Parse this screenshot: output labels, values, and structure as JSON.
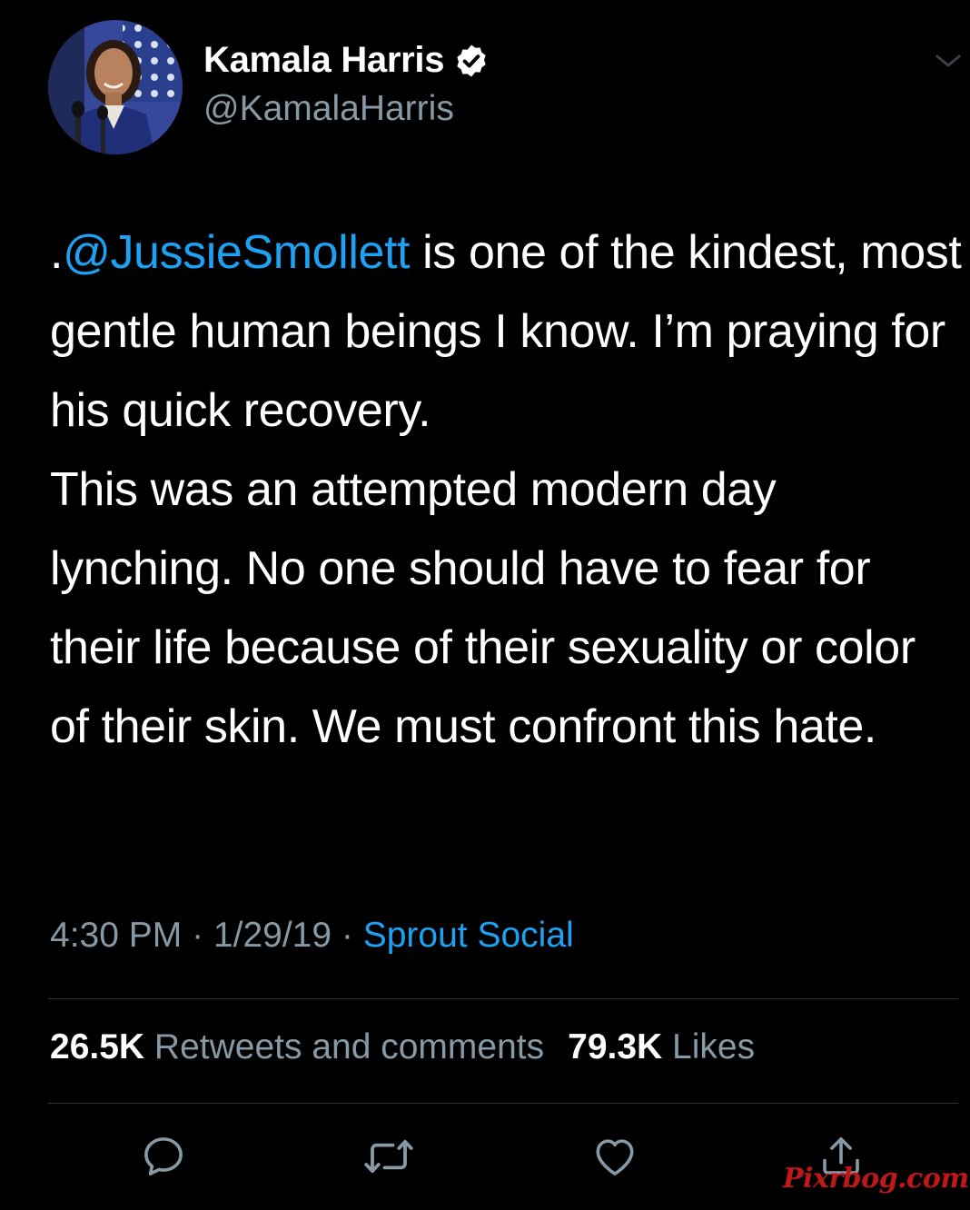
{
  "author": {
    "name": "Kamala Harris",
    "handle": "@KamalaHarris",
    "verified_icon": "verified-badge-icon",
    "menu_icon": "chevron-down-icon"
  },
  "tweet": {
    "prefix": ".",
    "mention": "@JussieSmollett",
    "paragraph1_rest": " is one of the kindest, most gentle human beings I know. I’m praying for his quick recovery.",
    "paragraph2": "This was an attempted modern day lynching. No one should have to fear for their life because of their sexuality or color of their skin. We must confront this hate."
  },
  "meta": {
    "time": "4:30 PM",
    "separator1": " · ",
    "date": "1/29/19",
    "separator2": " · ",
    "source": "Sprout Social"
  },
  "stats": {
    "retweets_count": "26.5K",
    "retweets_label": "Retweets and comments",
    "likes_count": "79.3K",
    "likes_label": "Likes"
  },
  "actions": [
    "reply-icon",
    "retweet-icon",
    "like-icon",
    "share-icon"
  ],
  "watermark": "Pixrbog.com",
  "colors": {
    "background": "#000000",
    "text": "#ffffff",
    "secondary": "#8899a6",
    "link": "#1da1f2",
    "divider": "#2f3336",
    "watermark": "#c01818"
  }
}
